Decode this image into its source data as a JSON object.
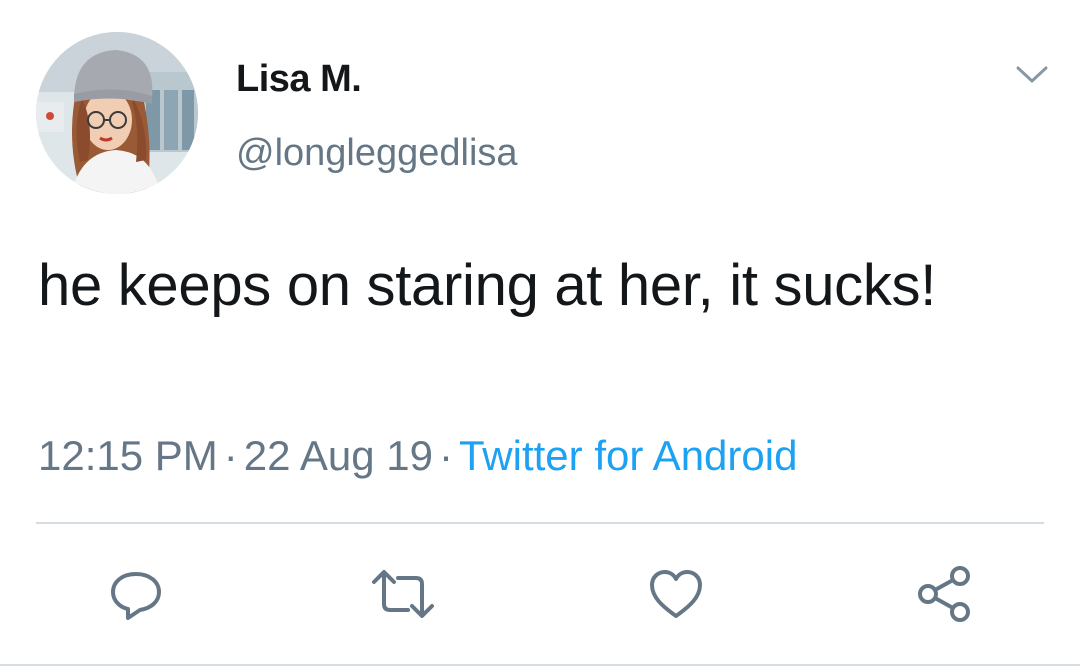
{
  "tweet": {
    "author": {
      "display_name": "Lisa M.",
      "handle": "@longleggedlisa",
      "avatar_icon": "profile-photo"
    },
    "text": "he keeps on staring at her, it sucks!",
    "meta": {
      "time": "12:15 PM",
      "separator": "·",
      "date": "22 Aug 19",
      "source": "Twitter for Android"
    },
    "actions": [
      {
        "icon": "reply-icon"
      },
      {
        "icon": "retweet-icon"
      },
      {
        "icon": "like-icon"
      },
      {
        "icon": "share-icon"
      }
    ]
  },
  "colors": {
    "text": "#14171a",
    "secondary": "#657786",
    "link": "#1da1f2",
    "icon": "#657786",
    "divider": "#d5dde2"
  }
}
